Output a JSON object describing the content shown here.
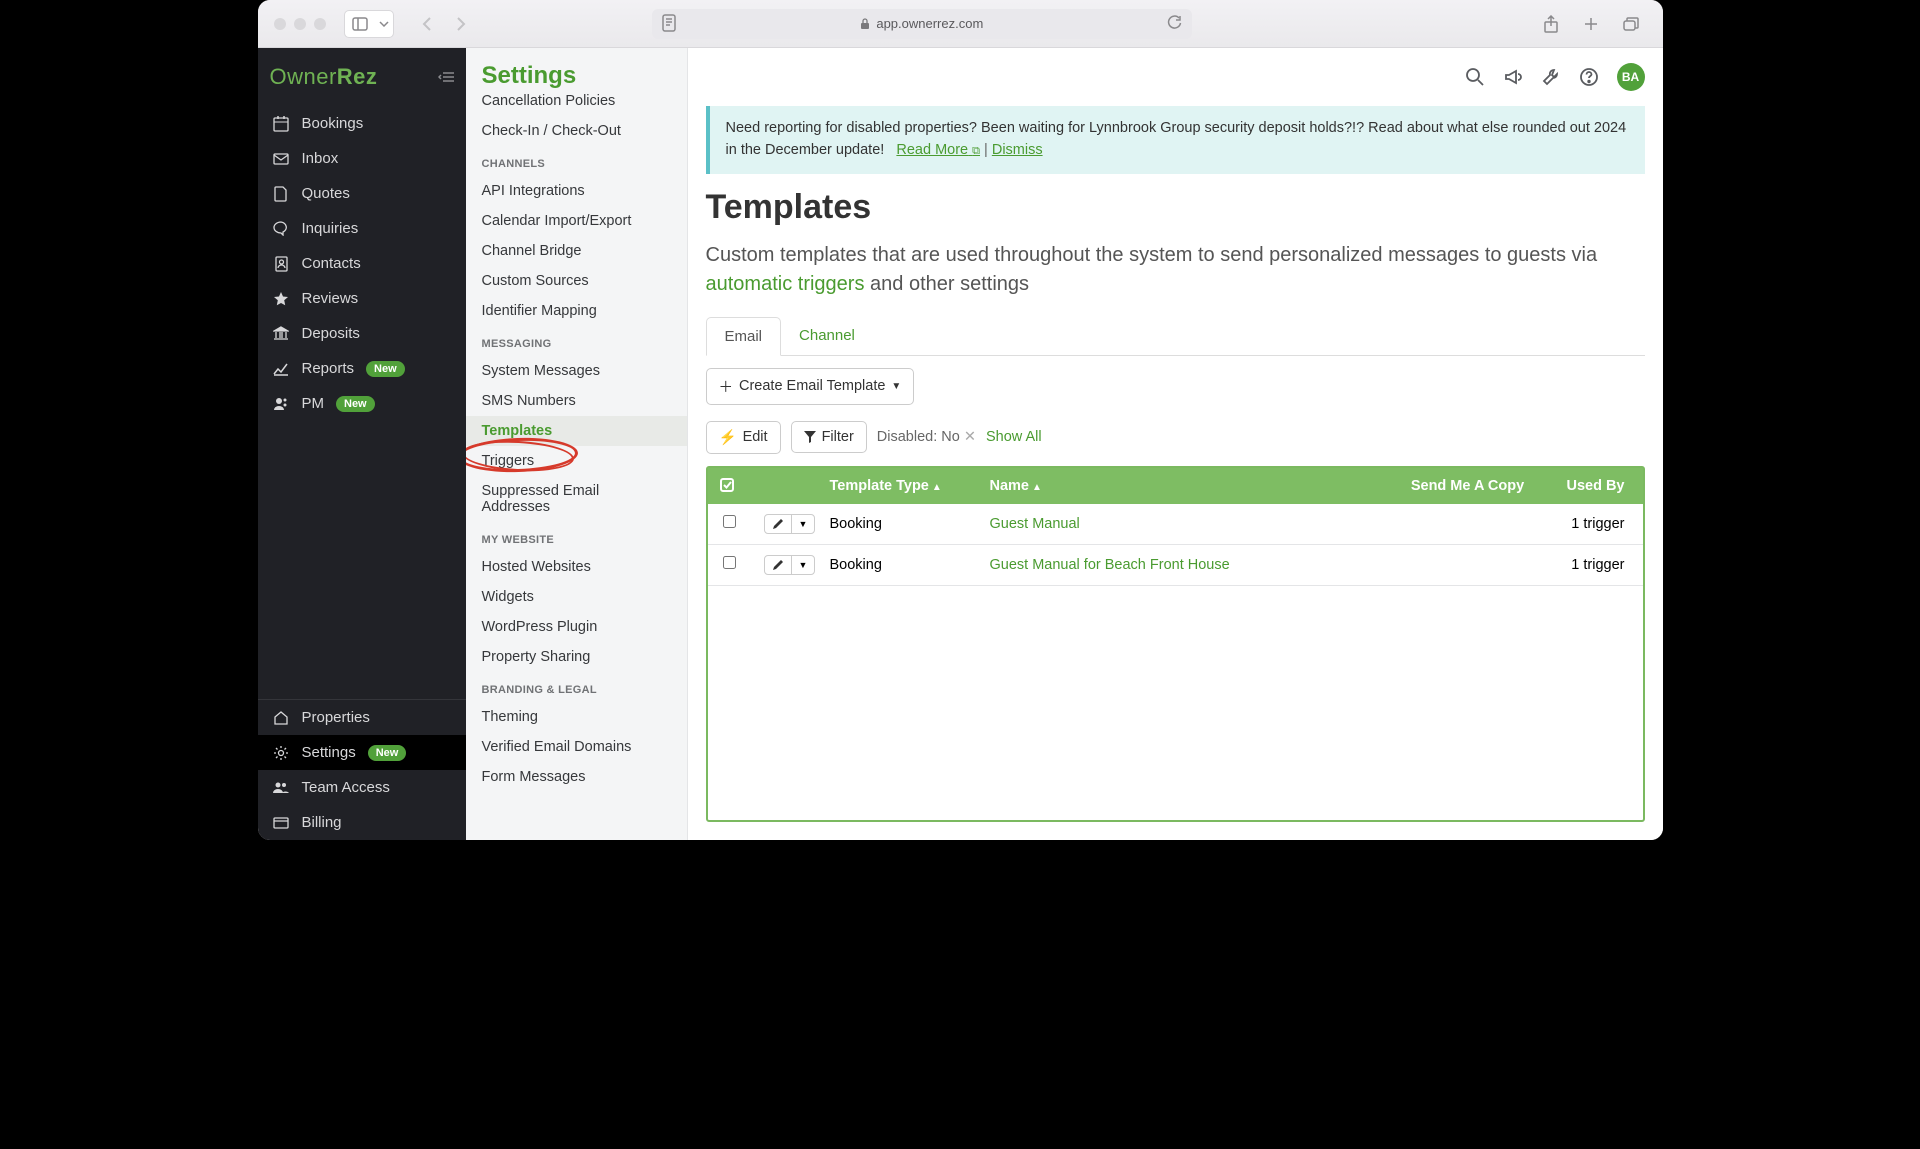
{
  "browser": {
    "url": "app.ownerrez.com"
  },
  "brand": {
    "part1": "Owner",
    "part2": "Rez"
  },
  "leftnav": {
    "items": [
      {
        "label": "Bookings"
      },
      {
        "label": "Inbox"
      },
      {
        "label": "Quotes"
      },
      {
        "label": "Inquiries"
      },
      {
        "label": "Contacts"
      },
      {
        "label": "Reviews"
      },
      {
        "label": "Deposits"
      },
      {
        "label": "Reports",
        "badge": "New"
      },
      {
        "label": "PM",
        "badge": "New"
      }
    ],
    "bottom": [
      {
        "label": "Properties"
      },
      {
        "label": "Settings",
        "badge": "New",
        "active": true
      },
      {
        "label": "Team Access"
      },
      {
        "label": "Billing"
      }
    ]
  },
  "topbar": {
    "avatar": "BA"
  },
  "settings": {
    "title": "Settings",
    "groups": [
      {
        "items": [
          {
            "label": "Cancellation Policies"
          },
          {
            "label": "Check-In / Check-Out"
          }
        ]
      },
      {
        "header": "CHANNELS",
        "items": [
          {
            "label": "API Integrations"
          },
          {
            "label": "Calendar Import/Export"
          },
          {
            "label": "Channel Bridge"
          },
          {
            "label": "Custom Sources"
          },
          {
            "label": "Identifier Mapping"
          }
        ]
      },
      {
        "header": "MESSAGING",
        "items": [
          {
            "label": "System Messages"
          },
          {
            "label": "SMS Numbers"
          },
          {
            "label": "Templates",
            "active": true
          },
          {
            "label": "Triggers",
            "circled": true
          },
          {
            "label": "Suppressed Email Addresses"
          }
        ]
      },
      {
        "header": "MY WEBSITE",
        "items": [
          {
            "label": "Hosted Websites"
          },
          {
            "label": "Widgets"
          },
          {
            "label": "WordPress Plugin"
          },
          {
            "label": "Property Sharing"
          }
        ]
      },
      {
        "header": "BRANDING & LEGAL",
        "items": [
          {
            "label": "Theming"
          },
          {
            "label": "Verified Email Domains"
          },
          {
            "label": "Form Messages"
          }
        ]
      }
    ]
  },
  "alert": {
    "text": "Need reporting for disabled properties? Been waiting for Lynnbrook Group security deposit holds?!? Read about what else rounded out 2024 in the December update!",
    "readmore": "Read More",
    "dismiss": "Dismiss"
  },
  "page": {
    "title": "Templates",
    "subtitle_pre": "Custom templates that are used throughout the system to send personalized messages to guests via ",
    "subtitle_link": "automatic triggers",
    "subtitle_post": " and other settings"
  },
  "tabs": {
    "email": "Email",
    "channel": "Channel"
  },
  "actions": {
    "create": "Create Email Template",
    "edit": "Edit",
    "filter": "Filter",
    "disabled_label": "Disabled: No",
    "showall": "Show All"
  },
  "table": {
    "headers": {
      "type": "Template Type",
      "name": "Name",
      "copy": "Send Me A Copy",
      "used": "Used By"
    },
    "rows": [
      {
        "type": "Booking",
        "name": "Guest Manual",
        "copy": "",
        "used": "1 trigger"
      },
      {
        "type": "Booking",
        "name": "Guest Manual for Beach Front House",
        "copy": "",
        "used": "1 trigger"
      }
    ]
  }
}
